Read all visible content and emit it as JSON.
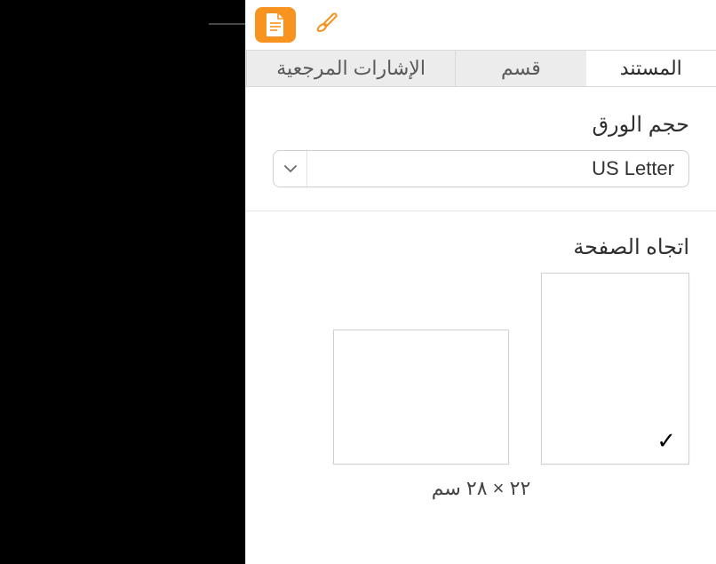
{
  "tabs": {
    "document": "المستند",
    "section": "قسم",
    "bookmarks": "الإشارات المرجعية"
  },
  "paper_size": {
    "label": "حجم الورق",
    "value": "US Letter"
  },
  "orientation": {
    "label": "اتجاه الصفحة",
    "dims": "٢٢ × ٢٨ سم"
  }
}
